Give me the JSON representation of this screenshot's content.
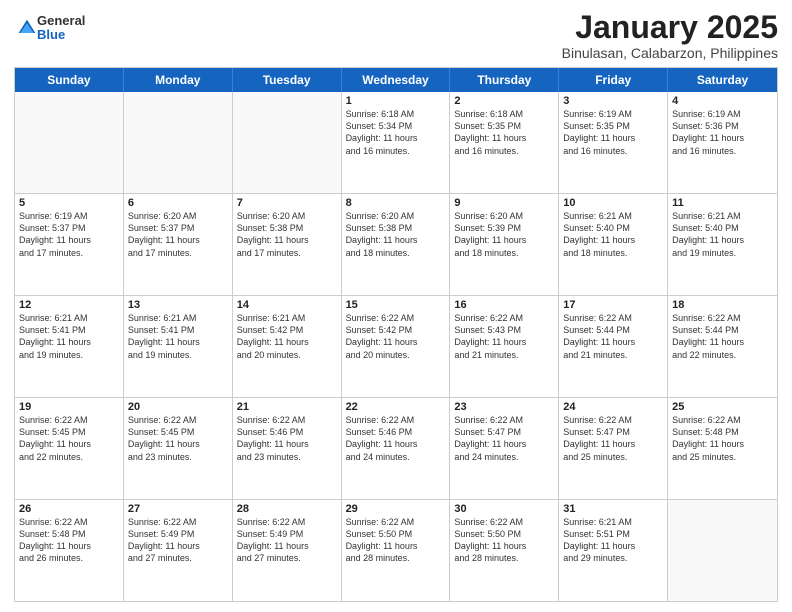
{
  "logo": {
    "general": "General",
    "blue": "Blue"
  },
  "title": "January 2025",
  "subtitle": "Binulasan, Calabarzon, Philippines",
  "header_days": [
    "Sunday",
    "Monday",
    "Tuesday",
    "Wednesday",
    "Thursday",
    "Friday",
    "Saturday"
  ],
  "weeks": [
    [
      {
        "day": "",
        "info": ""
      },
      {
        "day": "",
        "info": ""
      },
      {
        "day": "",
        "info": ""
      },
      {
        "day": "1",
        "info": "Sunrise: 6:18 AM\nSunset: 5:34 PM\nDaylight: 11 hours\nand 16 minutes."
      },
      {
        "day": "2",
        "info": "Sunrise: 6:18 AM\nSunset: 5:35 PM\nDaylight: 11 hours\nand 16 minutes."
      },
      {
        "day": "3",
        "info": "Sunrise: 6:19 AM\nSunset: 5:35 PM\nDaylight: 11 hours\nand 16 minutes."
      },
      {
        "day": "4",
        "info": "Sunrise: 6:19 AM\nSunset: 5:36 PM\nDaylight: 11 hours\nand 16 minutes."
      }
    ],
    [
      {
        "day": "5",
        "info": "Sunrise: 6:19 AM\nSunset: 5:37 PM\nDaylight: 11 hours\nand 17 minutes."
      },
      {
        "day": "6",
        "info": "Sunrise: 6:20 AM\nSunset: 5:37 PM\nDaylight: 11 hours\nand 17 minutes."
      },
      {
        "day": "7",
        "info": "Sunrise: 6:20 AM\nSunset: 5:38 PM\nDaylight: 11 hours\nand 17 minutes."
      },
      {
        "day": "8",
        "info": "Sunrise: 6:20 AM\nSunset: 5:38 PM\nDaylight: 11 hours\nand 18 minutes."
      },
      {
        "day": "9",
        "info": "Sunrise: 6:20 AM\nSunset: 5:39 PM\nDaylight: 11 hours\nand 18 minutes."
      },
      {
        "day": "10",
        "info": "Sunrise: 6:21 AM\nSunset: 5:40 PM\nDaylight: 11 hours\nand 18 minutes."
      },
      {
        "day": "11",
        "info": "Sunrise: 6:21 AM\nSunset: 5:40 PM\nDaylight: 11 hours\nand 19 minutes."
      }
    ],
    [
      {
        "day": "12",
        "info": "Sunrise: 6:21 AM\nSunset: 5:41 PM\nDaylight: 11 hours\nand 19 minutes."
      },
      {
        "day": "13",
        "info": "Sunrise: 6:21 AM\nSunset: 5:41 PM\nDaylight: 11 hours\nand 19 minutes."
      },
      {
        "day": "14",
        "info": "Sunrise: 6:21 AM\nSunset: 5:42 PM\nDaylight: 11 hours\nand 20 minutes."
      },
      {
        "day": "15",
        "info": "Sunrise: 6:22 AM\nSunset: 5:42 PM\nDaylight: 11 hours\nand 20 minutes."
      },
      {
        "day": "16",
        "info": "Sunrise: 6:22 AM\nSunset: 5:43 PM\nDaylight: 11 hours\nand 21 minutes."
      },
      {
        "day": "17",
        "info": "Sunrise: 6:22 AM\nSunset: 5:44 PM\nDaylight: 11 hours\nand 21 minutes."
      },
      {
        "day": "18",
        "info": "Sunrise: 6:22 AM\nSunset: 5:44 PM\nDaylight: 11 hours\nand 22 minutes."
      }
    ],
    [
      {
        "day": "19",
        "info": "Sunrise: 6:22 AM\nSunset: 5:45 PM\nDaylight: 11 hours\nand 22 minutes."
      },
      {
        "day": "20",
        "info": "Sunrise: 6:22 AM\nSunset: 5:45 PM\nDaylight: 11 hours\nand 23 minutes."
      },
      {
        "day": "21",
        "info": "Sunrise: 6:22 AM\nSunset: 5:46 PM\nDaylight: 11 hours\nand 23 minutes."
      },
      {
        "day": "22",
        "info": "Sunrise: 6:22 AM\nSunset: 5:46 PM\nDaylight: 11 hours\nand 24 minutes."
      },
      {
        "day": "23",
        "info": "Sunrise: 6:22 AM\nSunset: 5:47 PM\nDaylight: 11 hours\nand 24 minutes."
      },
      {
        "day": "24",
        "info": "Sunrise: 6:22 AM\nSunset: 5:47 PM\nDaylight: 11 hours\nand 25 minutes."
      },
      {
        "day": "25",
        "info": "Sunrise: 6:22 AM\nSunset: 5:48 PM\nDaylight: 11 hours\nand 25 minutes."
      }
    ],
    [
      {
        "day": "26",
        "info": "Sunrise: 6:22 AM\nSunset: 5:48 PM\nDaylight: 11 hours\nand 26 minutes."
      },
      {
        "day": "27",
        "info": "Sunrise: 6:22 AM\nSunset: 5:49 PM\nDaylight: 11 hours\nand 27 minutes."
      },
      {
        "day": "28",
        "info": "Sunrise: 6:22 AM\nSunset: 5:49 PM\nDaylight: 11 hours\nand 27 minutes."
      },
      {
        "day": "29",
        "info": "Sunrise: 6:22 AM\nSunset: 5:50 PM\nDaylight: 11 hours\nand 28 minutes."
      },
      {
        "day": "30",
        "info": "Sunrise: 6:22 AM\nSunset: 5:50 PM\nDaylight: 11 hours\nand 28 minutes."
      },
      {
        "day": "31",
        "info": "Sunrise: 6:21 AM\nSunset: 5:51 PM\nDaylight: 11 hours\nand 29 minutes."
      },
      {
        "day": "",
        "info": ""
      }
    ]
  ]
}
